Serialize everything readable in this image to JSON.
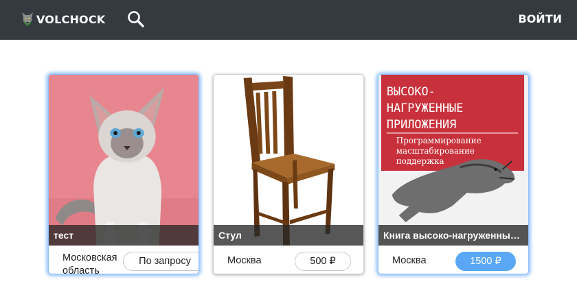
{
  "navbar": {
    "brand": "VOLCHOCK",
    "login": "ВОЙТИ"
  },
  "listings": [
    {
      "title": "тест",
      "city": "Московская область",
      "price": "По запросу"
    },
    {
      "title": "Стул",
      "city": "Москва",
      "price": "500 ₽"
    },
    {
      "title": "Книга высоко-нагруженные приложения",
      "city": "Москва",
      "price": "1500 ₽"
    }
  ],
  "book_cover": {
    "title_lines": [
      "ВЫСОКО-",
      "НАГРУЖЕННЫЕ",
      "ПРИЛОЖЕНИЯ"
    ],
    "subtitle_lines": [
      "Программирование",
      "масштабирование",
      "поддержка"
    ]
  },
  "icons": {
    "logo": "wolf-logo-icon",
    "search": "search-icon"
  },
  "colors": {
    "navbar": "#343a40",
    "accent": "#5aa7f5",
    "book_cover": "#c8313b"
  }
}
